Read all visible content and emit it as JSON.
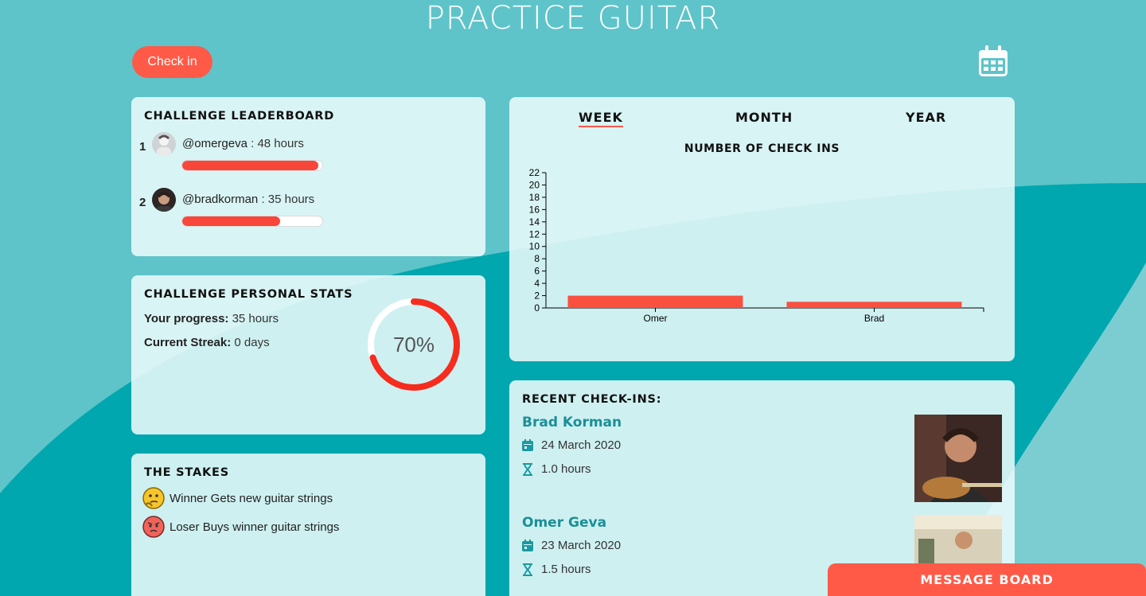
{
  "header": {
    "title": "PRACTICE GUITAR",
    "checkin_label": "Check in",
    "calendar_icon": "calendar-icon"
  },
  "leaderboard": {
    "title": "CHALLENGE LEADERBOARD",
    "rows": [
      {
        "rank": "1",
        "handle": "@omergeva",
        "sep": " : ",
        "hours": "48 hours",
        "progress": 0.97
      },
      {
        "rank": "2",
        "handle": "@bradkorman",
        "sep": " : ",
        "hours": "35 hours",
        "progress": 0.7
      }
    ]
  },
  "personal_stats": {
    "title": "CHALLENGE PERSONAL STATS",
    "progress_label": "Your progress:",
    "progress_value": "35 hours",
    "streak_label": "Current Streak:",
    "streak_value": "0 days",
    "percent_text": "70%",
    "percent": 0.7
  },
  "stakes": {
    "title": "THE STAKES",
    "winner": "Winner Gets new guitar strings",
    "loser": "Loser Buys winner guitar strings"
  },
  "chart_card": {
    "tabs": [
      {
        "label": "WEEK",
        "active": true
      },
      {
        "label": "MONTH",
        "active": false
      },
      {
        "label": "YEAR",
        "active": false
      }
    ]
  },
  "chart_data": {
    "type": "bar",
    "title": "NUMBER OF CHECK INS",
    "categories": [
      "Omer",
      "Brad"
    ],
    "values": [
      2,
      1
    ],
    "ylim": [
      0,
      22
    ],
    "yticks": [
      0,
      2,
      4,
      6,
      8,
      10,
      12,
      14,
      16,
      18,
      20,
      22
    ],
    "xlabel": "",
    "ylabel": "",
    "color": "#f9503f",
    "grid": false
  },
  "recent": {
    "title": "RECENT CHECK-INS:",
    "entries": [
      {
        "name": "Brad Korman",
        "date": "24 March 2020",
        "duration": "1.0 hours"
      },
      {
        "name": "Omer Geva",
        "date": "23 March 2020",
        "duration": "1.5 hours"
      }
    ]
  },
  "message_board": {
    "label": "MESSAGE BOARD"
  },
  "colors": {
    "accent": "#ff5a48",
    "bar": "#f8463a",
    "teal": "#00a7ae",
    "name_teal": "#1a8f96"
  }
}
